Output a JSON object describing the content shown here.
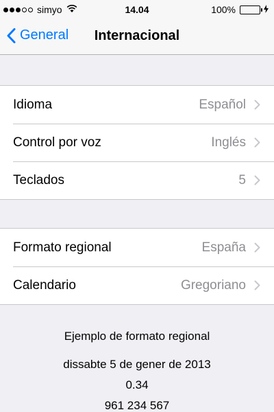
{
  "status_bar": {
    "carrier": "simyo",
    "time": "14.04",
    "battery_percent": "100%",
    "signal_bars_filled": 3,
    "signal_bars_total": 5,
    "battery_level": 1.0,
    "battery_color": "#4cd964"
  },
  "nav": {
    "back_label": "General",
    "title": "Internacional",
    "accent_color": "#007aff"
  },
  "group1": {
    "rows": [
      {
        "label": "Idioma",
        "value": "Español"
      },
      {
        "label": "Control por voz",
        "value": "Inglés"
      },
      {
        "label": "Teclados",
        "value": "5"
      }
    ]
  },
  "group2": {
    "rows": [
      {
        "label": "Formato regional",
        "value": "España"
      },
      {
        "label": "Calendario",
        "value": "Gregoriano"
      }
    ]
  },
  "footer": {
    "title": "Ejemplo de formato regional",
    "date": "dissabte 5 de gener de 2013",
    "number": "0.34",
    "phone": "961 234 567"
  },
  "icons": {
    "back": "chevron-left-icon",
    "row_chevron": "chevron-right-icon",
    "wifi": "wifi-icon",
    "battery": "battery-icon",
    "charging": "bolt-icon"
  }
}
